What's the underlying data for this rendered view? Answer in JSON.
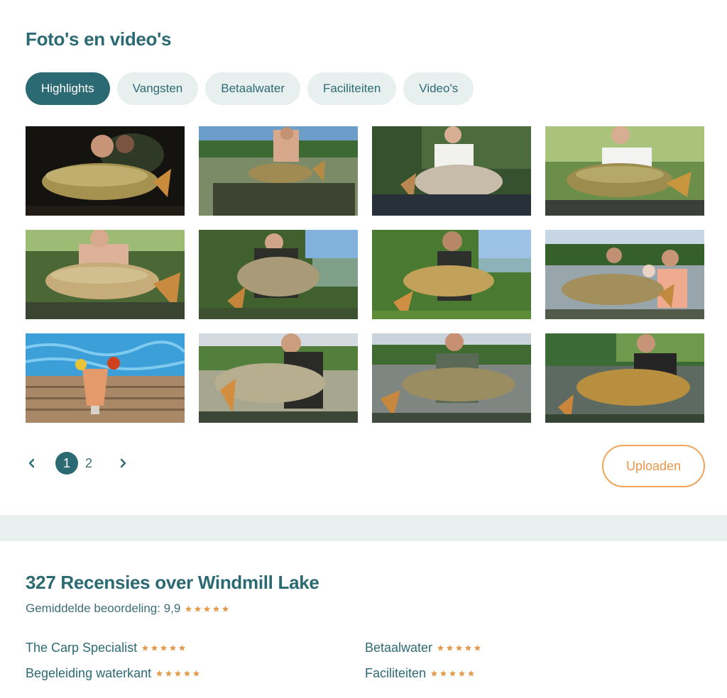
{
  "gallery": {
    "title": "Foto's en video's",
    "tabs": [
      {
        "label": "Highlights",
        "active": true
      },
      {
        "label": "Vangsten",
        "active": false
      },
      {
        "label": "Betaalwater",
        "active": false
      },
      {
        "label": "Faciliteiten",
        "active": false
      },
      {
        "label": "Video's",
        "active": false
      }
    ]
  },
  "pagination": {
    "pages": [
      "1",
      "2"
    ],
    "current": "1"
  },
  "upload": {
    "label": "Uploaden"
  },
  "reviews": {
    "title": "327 Recensies over Windmill Lake",
    "average_label": "Gemiddelde beoordeling: 9,9",
    "average_stars": 5,
    "categories": [
      {
        "label": "The Carp Specialist",
        "stars": 5
      },
      {
        "label": "Betaalwater",
        "stars": 5
      },
      {
        "label": "Begeleiding waterkant",
        "stars": 5
      },
      {
        "label": "Faciliteiten",
        "stars": 5
      }
    ]
  },
  "colors": {
    "primary": "#2b6a73",
    "tab_bg": "#e8efef",
    "accent": "#efa55a",
    "star": "#e59a4d"
  }
}
